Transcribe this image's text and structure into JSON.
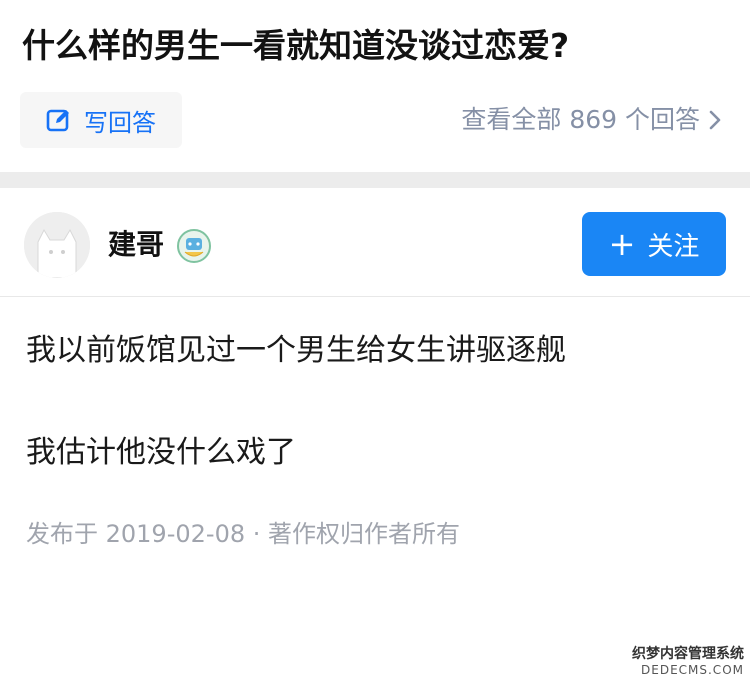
{
  "question": {
    "title": "什么样的男生一看就知道没谈过恋爱?",
    "write_answer_label": "写回答",
    "all_answers_label": "查看全部 869 个回答"
  },
  "author": {
    "name": "建哥",
    "follow_label": "关注"
  },
  "answer": {
    "paragraphs": [
      "我以前饭馆见过一个男生给女生讲驱逐舰",
      "我估计他没什么戏了"
    ],
    "meta": "发布于 2019-02-08 · 著作权归作者所有"
  },
  "watermark": {
    "line1": "织梦内容管理系统",
    "line2": "DEDECMS.COM"
  },
  "colors": {
    "accent": "#1a86f5",
    "link_blue": "#1772f6",
    "muted_text": "#8590a6",
    "section_gap": "#ececec"
  },
  "icons": {
    "write": "edit-icon",
    "chevron": "chevron-right-icon",
    "badge": "user-badge-icon",
    "plus": "plus-icon"
  }
}
